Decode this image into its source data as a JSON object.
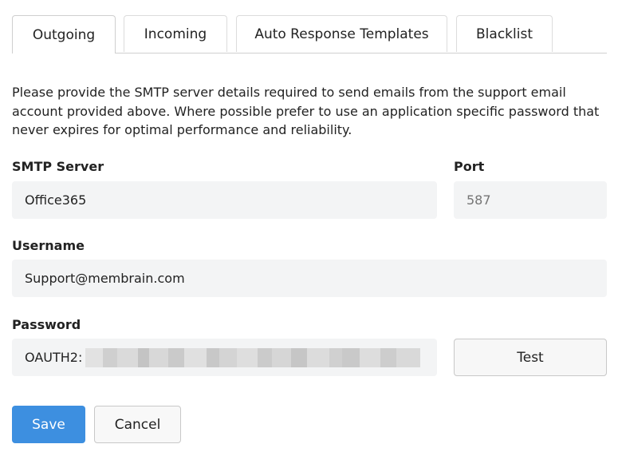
{
  "tabs": [
    {
      "label": "Outgoing",
      "active": true
    },
    {
      "label": "Incoming",
      "active": false
    },
    {
      "label": "Auto Response Templates",
      "active": false
    },
    {
      "label": "Blacklist",
      "active": false
    }
  ],
  "intro": "Please provide the SMTP server details required to send emails from the support email account provided above. Where possible prefer to use an application specific password that never expires for optimal performance and reliability.",
  "smtp": {
    "label": "SMTP Server",
    "value": "Office365"
  },
  "port": {
    "label": "Port",
    "placeholder": "587"
  },
  "username": {
    "label": "Username",
    "value": "Support@membrain.com"
  },
  "password": {
    "label": "Password",
    "prefix": "OAUTH2:"
  },
  "buttons": {
    "test": "Test",
    "save": "Save",
    "cancel": "Cancel"
  },
  "colors": {
    "primary": "#3d8fe0",
    "field_bg": "#f3f4f5"
  }
}
